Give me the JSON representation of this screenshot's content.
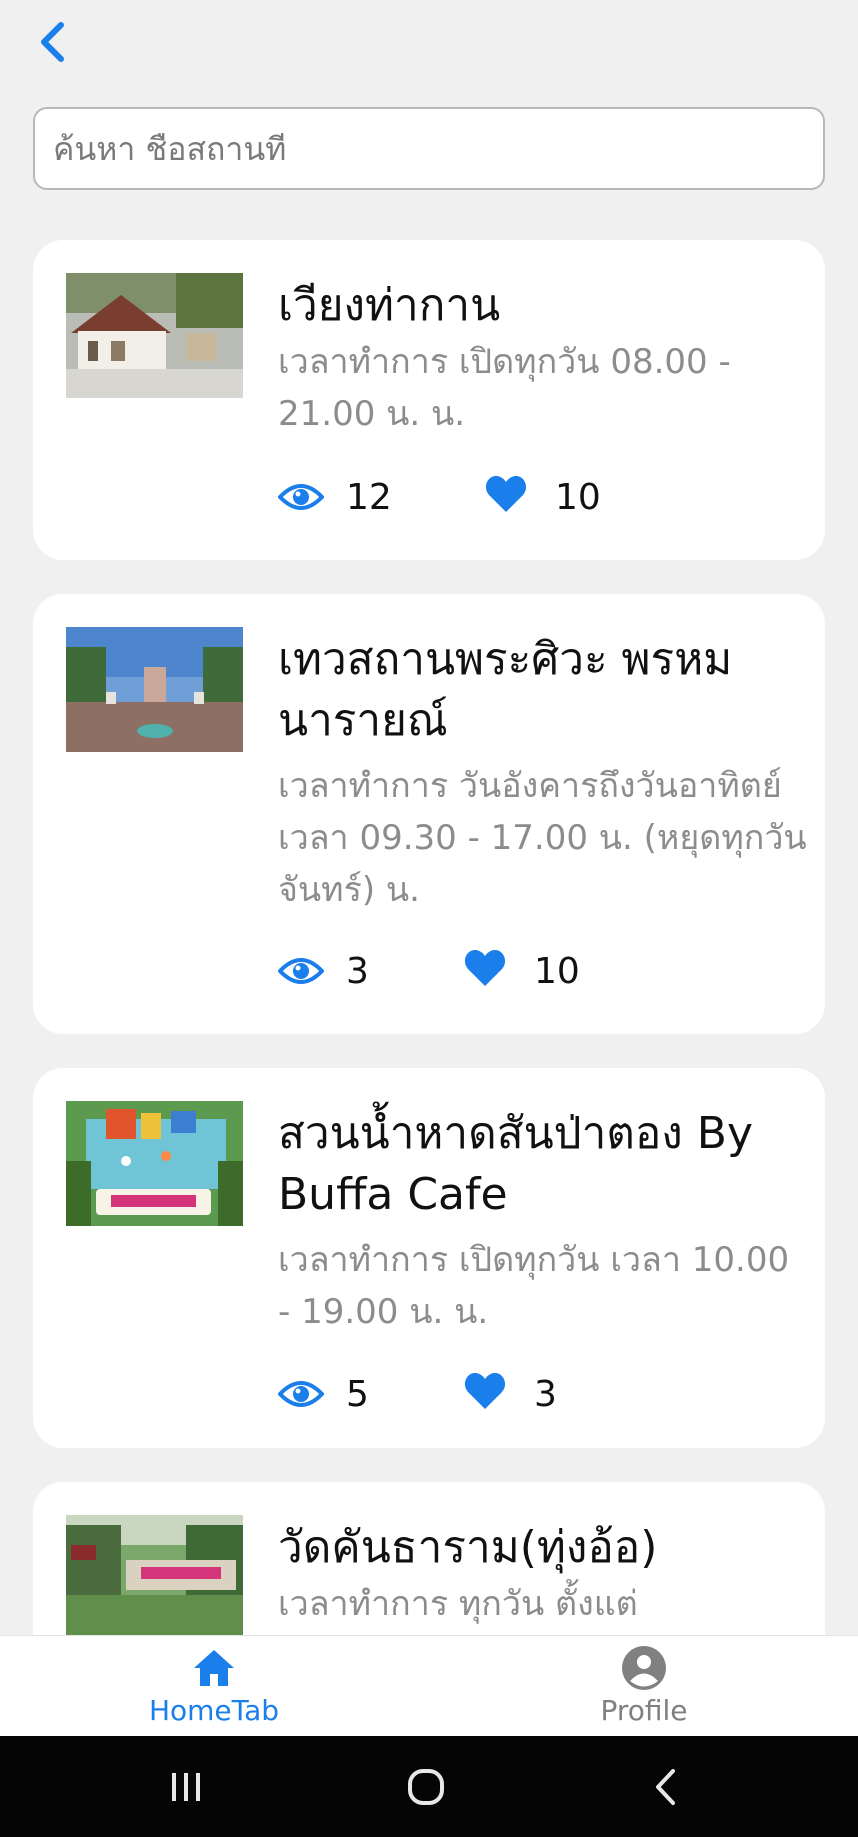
{
  "colors": {
    "accent": "#1a7fea",
    "muted_text": "#8c8c8c",
    "inactive_tab": "#808080",
    "background": "#f0f0f0"
  },
  "header": {
    "back_icon": "chevron-left-icon"
  },
  "search": {
    "placeholder": "ค้นหา ชือสถานที",
    "value": ""
  },
  "places": [
    {
      "title": "เวียงท่ากาน",
      "hours": "เวลาทำการ เปิดทุกวัน 08.00 - 21.00 น. น.",
      "views": "12",
      "likes": "10"
    },
    {
      "title": "เทวสถานพระศิวะ พรหมนารายณ์",
      "hours": "เวลาทำการ วันอังคารถึงวันอาทิตย์ เวลา 09.30 - 17.00 น. (หยุดทุกวันจันทร์) น.",
      "views": "3",
      "likes": "10"
    },
    {
      "title": "สวนน้ำหาดสันป่าตอง By Buffa Cafe",
      "hours": "เวลาทำการ เปิดทุกวัน เวลา 10.00 - 19.00 น. น.",
      "views": "5",
      "likes": "3"
    },
    {
      "title": "วัดคันธาราม(ทุ่งอ้อ)",
      "hours": "เวลาทำการ ทุกวัน ตั้งแต่",
      "views": "",
      "likes": ""
    }
  ],
  "tabs": [
    {
      "label": "HomeTab",
      "icon": "home-icon",
      "active": true
    },
    {
      "label": "Profile",
      "icon": "profile-icon",
      "active": false
    }
  ],
  "system_nav": [
    "recents-icon",
    "home-circle-icon",
    "back-icon"
  ]
}
